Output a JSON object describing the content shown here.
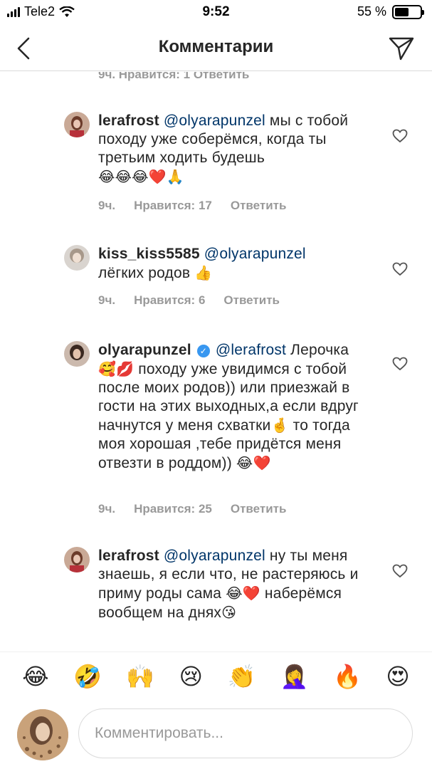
{
  "status": {
    "carrier": "Tele2",
    "time": "9:52",
    "battery": "55 %",
    "battery_level": 0.55
  },
  "nav": {
    "title": "Комментарии",
    "back_icon": "chevron-left-icon",
    "send_icon": "paper-plane-icon"
  },
  "partial": {
    "text": "9ч.   Нравится: 1   Ответить"
  },
  "comments": [
    {
      "user": "lerafrost",
      "mention": "@olyarapunzel",
      "text": " мы с тобой походу уже соберёмся, когда ты третьим ходить будешь",
      "emoji": "😂😂😂❤️🙏",
      "time": "9ч.",
      "likes": "Нравится: 17",
      "reply": "Ответить"
    },
    {
      "user": "kiss_kiss5585",
      "mention": "@olyarapunzel",
      "text": " лёгких родов",
      "emoji": "👍",
      "time": "9ч.",
      "likes": "Нравится: 6",
      "reply": "Ответить"
    },
    {
      "user": "olyarapunzel",
      "mention": "@lerafrost",
      "text_1": " Лерочка",
      "emoji_1": "🥰💋",
      "text_2": " походу уже увидимся с тобой после моих родов)) или приезжай в гости на этих выходных,а если вдруг начнутся у меня схватки",
      "emoji_2": "🤞",
      "text_3": " то тогда моя хорошая ,тебе придётся меня отвезти  в роддом)) ",
      "emoji_3": "😂❤️",
      "time": "9ч.",
      "likes": "Нравится: 25",
      "reply": "Ответить"
    },
    {
      "user": "lerafrost",
      "mention": "@olyarapunzel",
      "text_1": " ну ты меня знаешь, я если что, не растеряюсь и приму роды сама ",
      "emoji_1": "😂❤️",
      "text_2": "  наберёмся вообщем на днях",
      "emoji_2": "😘"
    }
  ],
  "emoji_bar": [
    "😂",
    "🤣",
    "🙌",
    "😢",
    "👏",
    "🤦‍♀️",
    "🔥",
    "😍"
  ],
  "input": {
    "placeholder": "Комментировать..."
  }
}
